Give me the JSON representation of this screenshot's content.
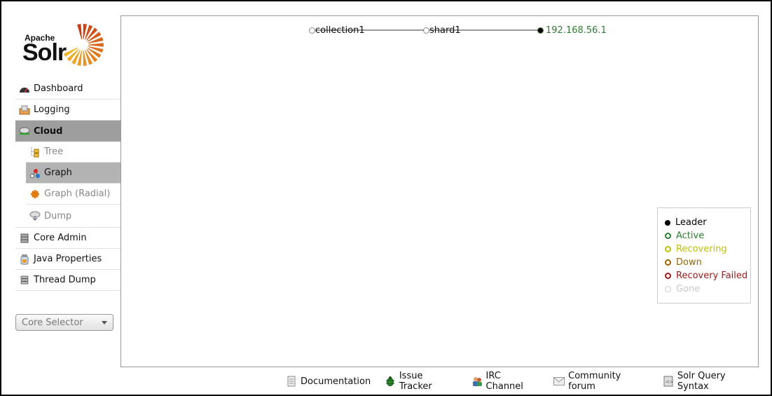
{
  "logo": {
    "top": "Apache",
    "main": "Solr"
  },
  "nav": {
    "items": [
      {
        "label": "Dashboard",
        "icon": "dashboard-icon"
      },
      {
        "label": "Logging",
        "icon": "logging-icon"
      },
      {
        "label": "Cloud",
        "icon": "cloud-icon",
        "active": true
      }
    ],
    "cloud_sub": [
      {
        "label": "Tree",
        "icon": "tree-icon"
      },
      {
        "label": "Graph",
        "icon": "graph-icon",
        "active": true
      },
      {
        "label": "Graph (Radial)",
        "icon": "graph-radial-icon"
      },
      {
        "label": "Dump",
        "icon": "dump-icon"
      }
    ],
    "items2": [
      {
        "label": "Core Admin",
        "icon": "core-admin-icon"
      },
      {
        "label": "Java Properties",
        "icon": "java-properties-icon"
      },
      {
        "label": "Thread Dump",
        "icon": "thread-dump-icon"
      }
    ]
  },
  "core_selector": {
    "label": "Core Selector"
  },
  "graph": {
    "nodes": [
      {
        "label": "collection1",
        "state": "collection"
      },
      {
        "label": "shard1",
        "state": "shard"
      },
      {
        "label": "192.168.56.1",
        "state": "leader-active"
      }
    ]
  },
  "legend": {
    "items": [
      {
        "label": "Leader",
        "color": "#000000",
        "filled": true
      },
      {
        "label": "Active",
        "color": "#2e7d32"
      },
      {
        "label": "Recovering",
        "color": "#c0c000"
      },
      {
        "label": "Down",
        "color": "#9a6400"
      },
      {
        "label": "Recovery Failed",
        "color": "#a11a1a"
      },
      {
        "label": "Gone",
        "color": "#c8c8c8"
      }
    ]
  },
  "footer": {
    "links": [
      {
        "label": "Documentation",
        "icon": "documentation-icon"
      },
      {
        "label": "Issue Tracker",
        "icon": "bug-icon"
      },
      {
        "label": "IRC Channel",
        "icon": "irc-users-icon"
      },
      {
        "label": "Community forum",
        "icon": "mail-icon"
      },
      {
        "label": "Solr Query Syntax",
        "icon": "query-syntax-icon"
      }
    ]
  }
}
